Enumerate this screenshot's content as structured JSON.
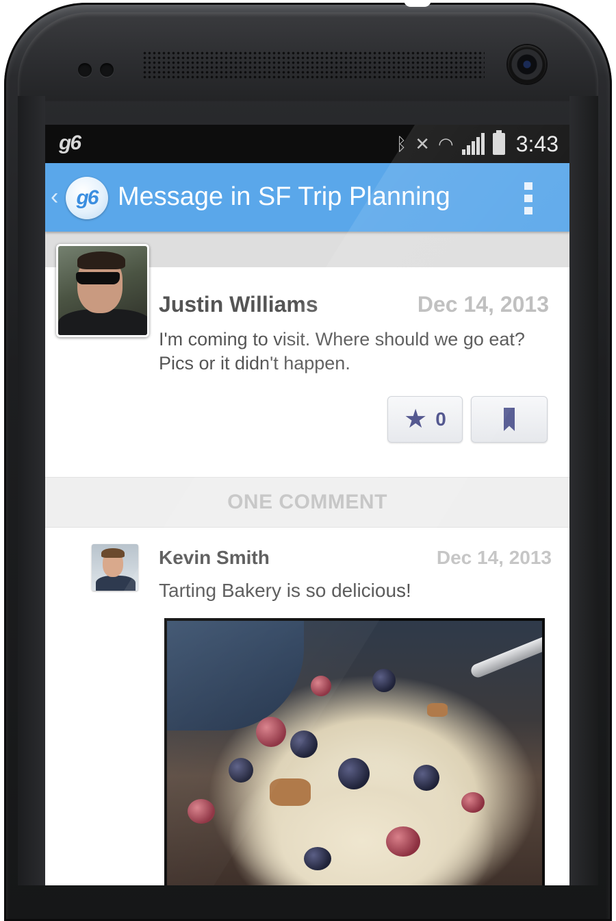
{
  "statusbar": {
    "app_icon": "g6-logo",
    "icons": [
      "bluetooth-icon",
      "mute-icon",
      "wifi-icon",
      "signal-icon",
      "battery-icon"
    ],
    "time": "3:43"
  },
  "actionbar": {
    "back_icon": "chevron-left-icon",
    "logo_text": "g6",
    "title": "Message in SF Trip Planning",
    "menu_icon": "overflow-menu-icon",
    "color": "#5aa7ea"
  },
  "post": {
    "author": "Justin Williams",
    "date": "Dec 14, 2013",
    "body": "I'm coming to visit. Where should we go eat? Pics or it didn't happen.",
    "star_count": "0",
    "star_icon": "star-icon",
    "bookmark_icon": "bookmark-icon"
  },
  "comments": {
    "header": "ONE COMMENT",
    "items": [
      {
        "author": "Kevin Smith",
        "date": "Dec 14, 2013",
        "body": "Tarting Bakery is so delicious!",
        "has_photo": true
      }
    ]
  }
}
